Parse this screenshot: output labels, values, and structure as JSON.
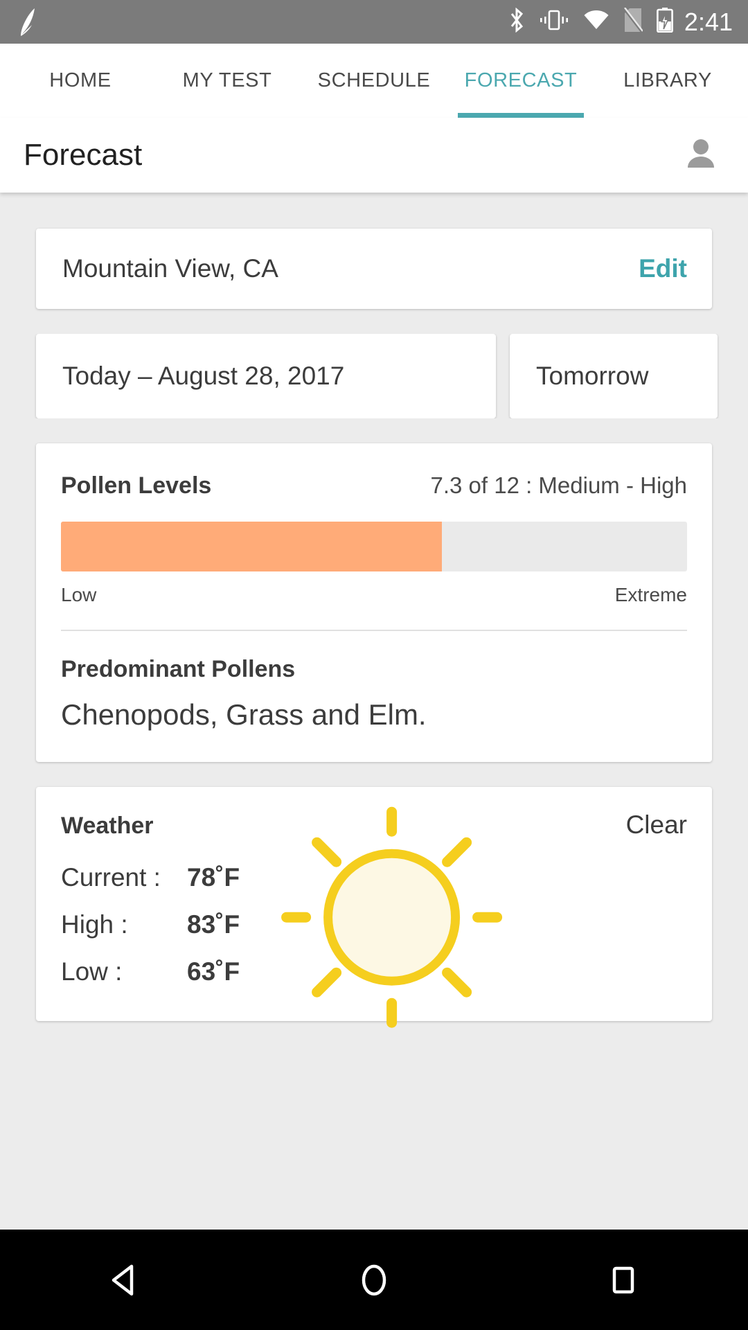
{
  "statusbar": {
    "app_logo": "leaf-logo",
    "icons": [
      "bluetooth-icon",
      "vibrate-icon",
      "wifi-icon",
      "no-sim-icon",
      "battery-charging-icon"
    ],
    "time": "2:41"
  },
  "tabs": [
    {
      "label": "HOME",
      "active": false
    },
    {
      "label": "MY TEST",
      "active": false
    },
    {
      "label": "SCHEDULE",
      "active": false
    },
    {
      "label": "FORECAST",
      "active": true
    },
    {
      "label": "LIBRARY",
      "active": false
    }
  ],
  "header": {
    "title": "Forecast",
    "avatar": "account-avatar-icon"
  },
  "location": {
    "name": "Mountain View, CA",
    "edit_label": "Edit"
  },
  "days": [
    {
      "label": "Today – August 28, 2017",
      "selected": true
    },
    {
      "label": "Tomorrow",
      "selected": false
    }
  ],
  "pollen": {
    "title": "Pollen Levels",
    "score_text": "7.3 of 12 : Medium - High",
    "value": 7.3,
    "max": 12,
    "fill_percent": 60.8,
    "scale_low": "Low",
    "scale_high": "Extreme",
    "predominant_title": "Predominant Pollens",
    "predominant_value": "Chenopods, Grass and Elm."
  },
  "weather": {
    "title": "Weather",
    "condition": "Clear",
    "icon": "sun-icon",
    "rows": [
      {
        "label": "Current :",
        "value": "78˚F"
      },
      {
        "label": "High :",
        "value": "83˚F"
      },
      {
        "label": "Low :",
        "value": "63˚F"
      }
    ]
  },
  "navbar": {
    "back": "back-triangle-icon",
    "home": "home-circle-icon",
    "recents": "recents-square-icon"
  },
  "colors": {
    "accent_teal": "#4BA8AF",
    "pollen_orange": "#FFAB78",
    "sun_yellow": "#F5CE1E",
    "statusbar_gray": "#7B7B7B",
    "page_background": "#ECECEC"
  }
}
